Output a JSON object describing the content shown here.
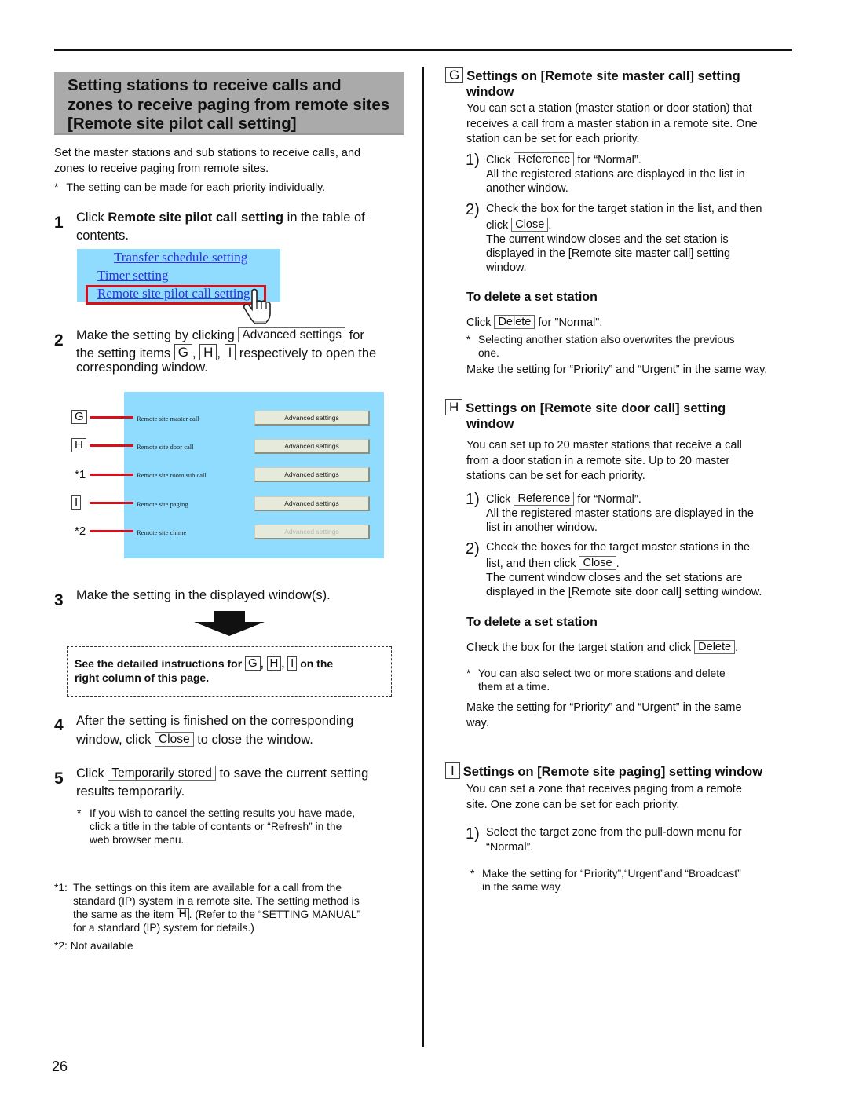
{
  "page_number": "26",
  "left": {
    "title_lines": [
      "Setting stations to receive calls and",
      "zones to receive paging from remote sites",
      "[Remote site pilot call setting]"
    ],
    "intro_lines": [
      "Set the master stations and sub stations to receive calls, and",
      "zones to receive paging from remote sites."
    ],
    "intro_note": "The setting can be made for each priority individually.",
    "note_marker": "*",
    "step1": {
      "num": "1",
      "pre": "Click ",
      "bold": "Remote site pilot call setting",
      "post": " in the table of",
      "line2": "contents.",
      "toc_items": [
        "Transfer schedule setting",
        "Timer setting",
        "Remote site pilot call setting"
      ]
    },
    "step2": {
      "num": "2",
      "pre": "Make the setting by clicking",
      "button": "Advanced settings",
      "post": "for",
      "line2_pre": "the setting items",
      "letters": [
        "G",
        "H",
        "I"
      ],
      "line2_post": "respectively to open the",
      "line3": "corresponding window."
    },
    "panel": {
      "rows": [
        {
          "marker_type": "letter",
          "marker": "G",
          "label": "Remote site master call",
          "button": "Advanced settings",
          "enabled": true
        },
        {
          "marker_type": "letter",
          "marker": "H",
          "label": "Remote site door call",
          "button": "Advanced settings",
          "enabled": true
        },
        {
          "marker_type": "footnote",
          "marker": "*1",
          "label": "Remote site room sub call",
          "button": "Advanced settings",
          "enabled": true
        },
        {
          "marker_type": "letter",
          "marker": "I",
          "label": "Remote site paging",
          "button": "Advanced settings",
          "enabled": true
        },
        {
          "marker_type": "footnote",
          "marker": "*2",
          "label": "Remote site chime",
          "button": "Advanced settings",
          "enabled": false
        }
      ]
    },
    "step3": {
      "num": "3",
      "text": "Make the setting in the displayed window(s).",
      "box_pre": "See the detailed instructions for",
      "box_letters": [
        "G",
        "H",
        "I"
      ],
      "box_post": "on the",
      "box_line2": "right column of this page."
    },
    "step4": {
      "num": "4",
      "line1": "After the setting is finished on the corresponding",
      "line2_pre": "window, click",
      "button": "Close",
      "line2_post": "to close the window."
    },
    "step5": {
      "num": "5",
      "pre": "Click",
      "button": "Temporarily stored",
      "post": "to save the current setting",
      "line2": "results temporarily.",
      "note_lines": [
        "If you wish to cancel the setting results you have made,",
        "click a title in the table of contents or “Refresh” in the",
        "web browser menu."
      ]
    },
    "footnotes": {
      "fn1_marker": "*1:",
      "fn1_line1": "The settings on this item are available for a call from the",
      "fn1_line2": "standard (IP) system in a remote site. The setting method is",
      "fn1_line3_pre": "the same as the item",
      "fn1_letter": "H",
      "fn1_line3_post": ". (Refer to the “SETTING MANUAL”",
      "fn1_line4": "for a standard (IP) system for details.)",
      "fn2_marker": "*2:",
      "fn2_text": "Not available"
    }
  },
  "right": {
    "G": {
      "letter": "G",
      "title_line1": "Settings on [Remote site master call] setting",
      "title_line2": "window",
      "desc_lines": [
        "You can set a station (master station or door station) that",
        "receives a call from a master station in a remote site. One",
        "station can be set for each priority."
      ],
      "item1": {
        "num": "1)",
        "pre": "Click",
        "button": "Reference",
        "post": "for “Normal”.",
        "sub_lines": [
          "All the registered stations are displayed in the list in",
          "another window."
        ]
      },
      "item2": {
        "num": "2)",
        "line1": "Check the box for the target station in the list, and then",
        "pre": "click",
        "button": "Close",
        "post": ".",
        "sub_lines": [
          "The current window closes and the set station is",
          "displayed in the [Remote site master call] setting",
          "window."
        ]
      },
      "delete_title": "To delete a set station",
      "delete_pre": "Click",
      "delete_button": "Delete",
      "delete_post": "for \"Normal\".",
      "delete_note_lines": [
        "Selecting another station also overwrites the previous",
        "one."
      ],
      "same_way": "Make the setting for “Priority” and “Urgent” in the same way."
    },
    "H": {
      "letter": "H",
      "title_line1": "Settings on [Remote site door call] setting",
      "title_line2": "window",
      "desc_lines": [
        "You can set up to 20 master stations that receive a call",
        "from a door station in a remote site. Up to 20 master",
        "stations can be set for each priority."
      ],
      "item1": {
        "num": "1)",
        "pre": "Click",
        "button": "Reference",
        "post": "for “Normal”.",
        "sub_lines": [
          "All the registered master stations are displayed in the",
          "list in another window."
        ]
      },
      "item2": {
        "num": "2)",
        "line1": "Check the boxes for the target master stations in the",
        "pre": "list, and then click",
        "button": "Close",
        "post": ".",
        "sub_lines": [
          "The current window closes and the set stations are",
          "displayed in the [Remote site door call] setting window."
        ]
      },
      "delete_title": "To delete a set station",
      "delete_pre": "Check the box for the target station and click",
      "delete_button": "Delete",
      "delete_post": ".",
      "delete_note_lines": [
        "You can also select two or more stations and delete",
        "them at a time."
      ],
      "same_way_lines": [
        "Make the setting for “Priority” and “Urgent” in the same",
        "way."
      ]
    },
    "I": {
      "letter": "I",
      "title": "Settings on [Remote site paging] setting window",
      "desc_lines": [
        "You can set a zone that receives paging from a remote",
        "site. One zone can be set for each priority."
      ],
      "item1": {
        "num": "1)",
        "lines": [
          "Select the target zone from the pull-down menu for",
          "“Normal”."
        ]
      },
      "note_lines": [
        "Make the setting for “Priority”,“Urgent”and “Broadcast”",
        "in the same way."
      ]
    }
  }
}
